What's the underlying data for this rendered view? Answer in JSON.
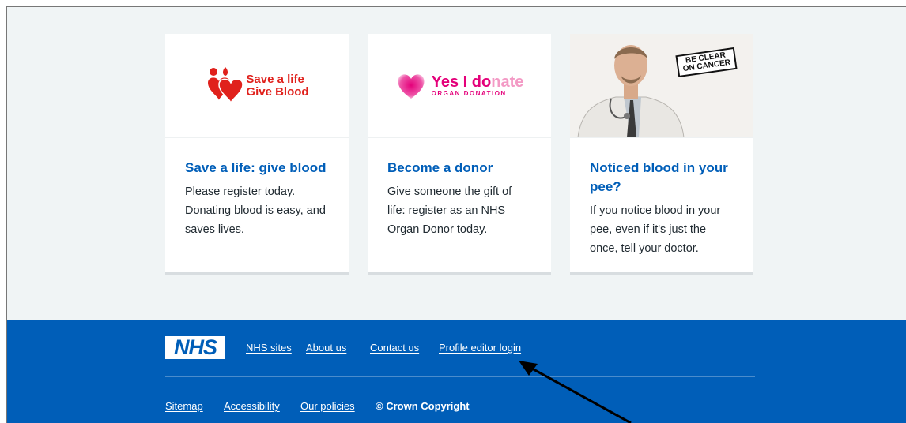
{
  "cards": [
    {
      "logo_line1": "Save a life",
      "logo_line2": "Give Blood",
      "title": "Save a life: give blood",
      "description": "Please register today. Donating blood is easy, and saves lives."
    },
    {
      "logo_main_a": "Yes I do",
      "logo_main_b": "nate",
      "logo_sub": "ORGAN DONATION",
      "title": "Become a donor",
      "description": "Give someone the gift of life: register as an NHS Organ Donor today."
    },
    {
      "badge_line1": "BE CLEAR",
      "badge_line2": "ON CANCER",
      "title": "Noticed blood in your pee?",
      "description": "If you notice blood in your pee, even if it's just the once, tell your doctor."
    }
  ],
  "footer": {
    "logo": "NHS",
    "primary_links": [
      "NHS sites",
      "About us",
      "Contact us",
      "Profile editor login"
    ],
    "secondary_links": [
      "Sitemap",
      "Accessibility",
      "Our policies"
    ],
    "copyright": "© Crown Copyright"
  },
  "colors": {
    "page_bg": "#f0f4f5",
    "footer_bg": "#005eb8",
    "link": "#005eb8",
    "blood_red": "#e0211c",
    "donate_pink": "#e4007a"
  }
}
